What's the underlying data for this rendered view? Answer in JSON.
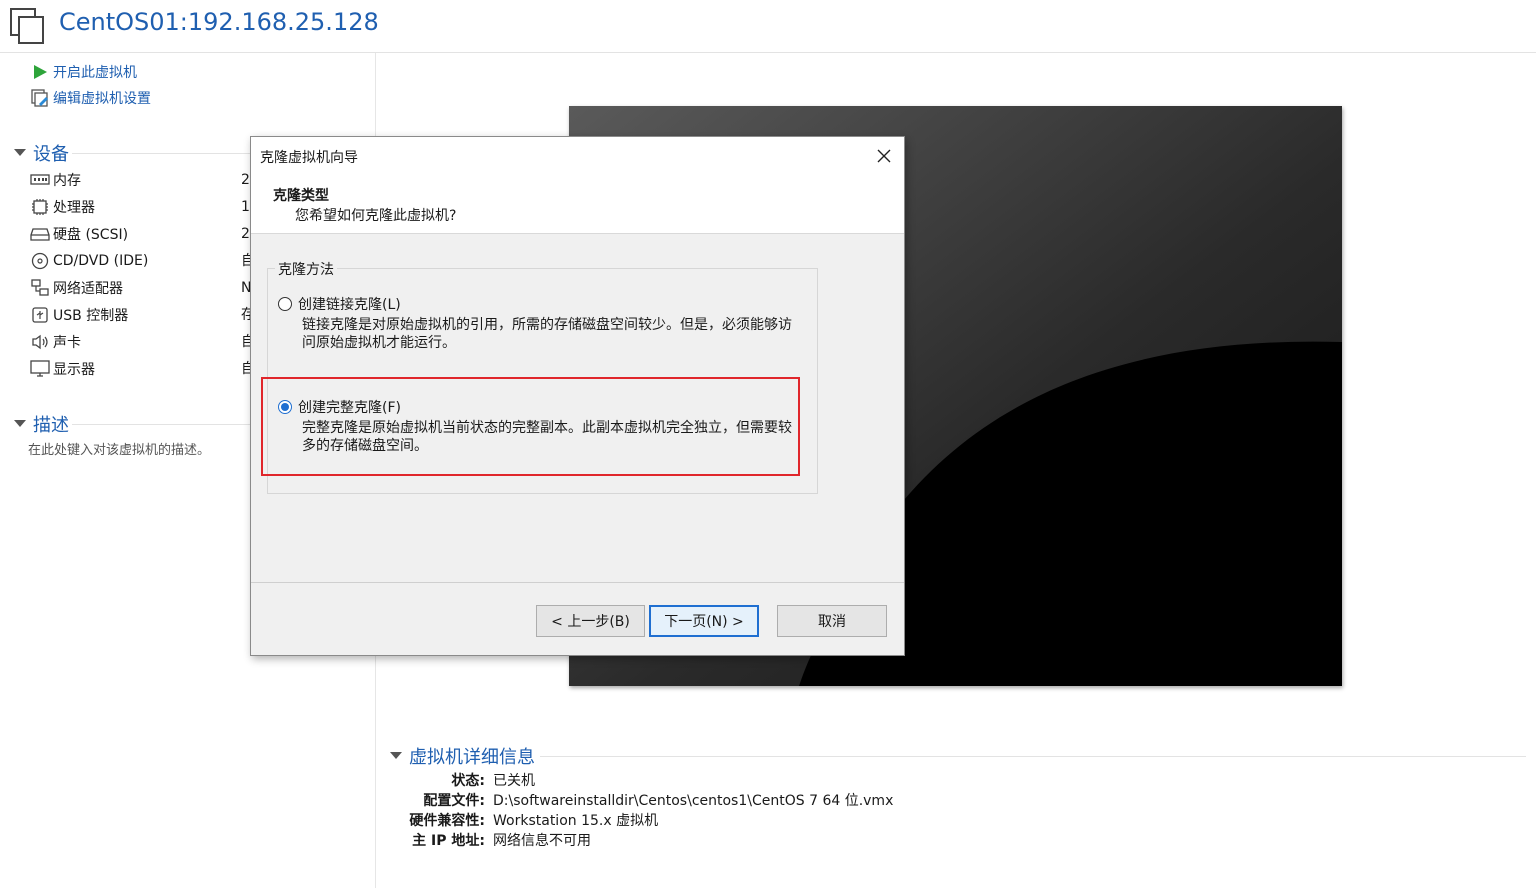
{
  "window": {
    "title": "CentOS01:192.168.25.128"
  },
  "commands": [
    {
      "label": "开启此虚拟机",
      "icon": "play-icon"
    },
    {
      "label": "编辑虚拟机设置",
      "icon": "edit-settings-icon"
    }
  ],
  "devices_section": {
    "title": "设备",
    "items": [
      {
        "name": "内存",
        "value": "2",
        "icon": "memory-icon"
      },
      {
        "name": "处理器",
        "value": "1",
        "icon": "processor-icon"
      },
      {
        "name": "硬盘 (SCSI)",
        "value": "2",
        "icon": "hard-disk-icon"
      },
      {
        "name": "CD/DVD (IDE)",
        "value": "自",
        "icon": "cd-dvd-icon"
      },
      {
        "name": "网络适配器",
        "value": "N",
        "icon": "network-adapter-icon"
      },
      {
        "name": "USB 控制器",
        "value": "存",
        "icon": "usb-controller-icon"
      },
      {
        "name": "声卡",
        "value": "自",
        "icon": "sound-card-icon"
      },
      {
        "name": "显示器",
        "value": "自",
        "icon": "display-icon"
      }
    ]
  },
  "description_section": {
    "title": "描述",
    "placeholder": "在此处键入对该虚拟机的描述。"
  },
  "details_section": {
    "title": "虚拟机详细信息",
    "rows": [
      {
        "key": "状态:",
        "value": "已关机"
      },
      {
        "key": "配置文件:",
        "value": "D:\\softwareinstalldir\\Centos\\centos1\\CentOS 7 64 位.vmx"
      },
      {
        "key": "硬件兼容性:",
        "value": "Workstation 15.x 虚拟机"
      },
      {
        "key": "主 IP 地址:",
        "value": "网络信息不可用"
      }
    ]
  },
  "dialog": {
    "title": "克隆虚拟机向导",
    "heading": "克隆类型",
    "subheading": "您希望如何克隆此虚拟机?",
    "group_label": "克隆方法",
    "options": [
      {
        "label": "创建链接克隆(L)",
        "description": "链接克隆是对原始虚拟机的引用，所需的存储磁盘空间较少。但是，必须能够访问原始虚拟机才能运行。",
        "selected": false
      },
      {
        "label": "创建完整克隆(F)",
        "description": "完整克隆是原始虚拟机当前状态的完整副本。此副本虚拟机完全独立，但需要较多的存储磁盘空间。",
        "selected": true
      }
    ],
    "buttons": {
      "back": "< 上一步(B)",
      "next": "下一页(N) >",
      "cancel": "取消"
    }
  },
  "colors": {
    "accent": "#1f5fb0",
    "highlight_box": "#e0262b",
    "radio_selected": "#1f6fd1"
  }
}
